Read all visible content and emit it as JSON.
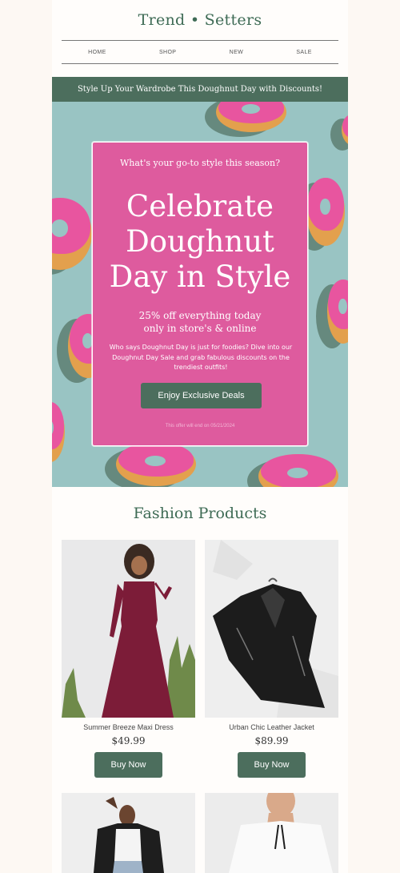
{
  "header": {
    "brand": "Trend • Setters",
    "nav": [
      "HOME",
      "SHOP",
      "NEW",
      "SALE"
    ]
  },
  "promo_bar": "Style Up Your Wardrobe This Doughnut Day with Discounts!",
  "hero": {
    "question": "What's your go-to style this season?",
    "headline_lines": [
      "Celebrate",
      "Doughnut",
      "Day in Style"
    ],
    "offer_lines": [
      "25% off everything today",
      "only in store's & online"
    ],
    "description": "Who says Doughnut Day is just for foodies? Dive into our Doughnut Day Sale and grab fabulous discounts on the trendiest outfits!",
    "cta": "Enjoy Exclusive Deals",
    "fine_print": "This offer will end on 05/21/2024"
  },
  "products_section": {
    "title": "Fashion Products",
    "items": [
      {
        "name": "Summer Breeze Maxi Dress",
        "price": "$49.99",
        "button": "Buy Now"
      },
      {
        "name": "Urban Chic Leather Jacket",
        "price": "$89.99",
        "button": "Buy Now"
      }
    ]
  },
  "colors": {
    "brand_green": "#4c6e5d",
    "hero_pink": "#de5b9e",
    "hero_teal": "#99c4c3"
  }
}
